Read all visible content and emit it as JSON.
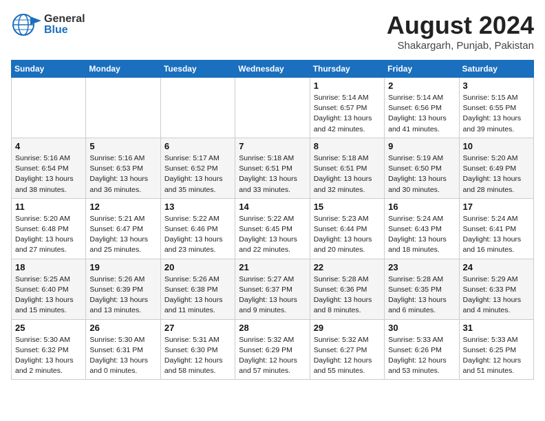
{
  "header": {
    "logo_general": "General",
    "logo_blue": "Blue",
    "month": "August 2024",
    "location": "Shakargarh, Punjab, Pakistan"
  },
  "days_of_week": [
    "Sunday",
    "Monday",
    "Tuesday",
    "Wednesday",
    "Thursday",
    "Friday",
    "Saturday"
  ],
  "weeks": [
    [
      {
        "num": "",
        "info": ""
      },
      {
        "num": "",
        "info": ""
      },
      {
        "num": "",
        "info": ""
      },
      {
        "num": "",
        "info": ""
      },
      {
        "num": "1",
        "info": "Sunrise: 5:14 AM\nSunset: 6:57 PM\nDaylight: 13 hours\nand 42 minutes."
      },
      {
        "num": "2",
        "info": "Sunrise: 5:14 AM\nSunset: 6:56 PM\nDaylight: 13 hours\nand 41 minutes."
      },
      {
        "num": "3",
        "info": "Sunrise: 5:15 AM\nSunset: 6:55 PM\nDaylight: 13 hours\nand 39 minutes."
      }
    ],
    [
      {
        "num": "4",
        "info": "Sunrise: 5:16 AM\nSunset: 6:54 PM\nDaylight: 13 hours\nand 38 minutes."
      },
      {
        "num": "5",
        "info": "Sunrise: 5:16 AM\nSunset: 6:53 PM\nDaylight: 13 hours\nand 36 minutes."
      },
      {
        "num": "6",
        "info": "Sunrise: 5:17 AM\nSunset: 6:52 PM\nDaylight: 13 hours\nand 35 minutes."
      },
      {
        "num": "7",
        "info": "Sunrise: 5:18 AM\nSunset: 6:51 PM\nDaylight: 13 hours\nand 33 minutes."
      },
      {
        "num": "8",
        "info": "Sunrise: 5:18 AM\nSunset: 6:51 PM\nDaylight: 13 hours\nand 32 minutes."
      },
      {
        "num": "9",
        "info": "Sunrise: 5:19 AM\nSunset: 6:50 PM\nDaylight: 13 hours\nand 30 minutes."
      },
      {
        "num": "10",
        "info": "Sunrise: 5:20 AM\nSunset: 6:49 PM\nDaylight: 13 hours\nand 28 minutes."
      }
    ],
    [
      {
        "num": "11",
        "info": "Sunrise: 5:20 AM\nSunset: 6:48 PM\nDaylight: 13 hours\nand 27 minutes."
      },
      {
        "num": "12",
        "info": "Sunrise: 5:21 AM\nSunset: 6:47 PM\nDaylight: 13 hours\nand 25 minutes."
      },
      {
        "num": "13",
        "info": "Sunrise: 5:22 AM\nSunset: 6:46 PM\nDaylight: 13 hours\nand 23 minutes."
      },
      {
        "num": "14",
        "info": "Sunrise: 5:22 AM\nSunset: 6:45 PM\nDaylight: 13 hours\nand 22 minutes."
      },
      {
        "num": "15",
        "info": "Sunrise: 5:23 AM\nSunset: 6:44 PM\nDaylight: 13 hours\nand 20 minutes."
      },
      {
        "num": "16",
        "info": "Sunrise: 5:24 AM\nSunset: 6:43 PM\nDaylight: 13 hours\nand 18 minutes."
      },
      {
        "num": "17",
        "info": "Sunrise: 5:24 AM\nSunset: 6:41 PM\nDaylight: 13 hours\nand 16 minutes."
      }
    ],
    [
      {
        "num": "18",
        "info": "Sunrise: 5:25 AM\nSunset: 6:40 PM\nDaylight: 13 hours\nand 15 minutes."
      },
      {
        "num": "19",
        "info": "Sunrise: 5:26 AM\nSunset: 6:39 PM\nDaylight: 13 hours\nand 13 minutes."
      },
      {
        "num": "20",
        "info": "Sunrise: 5:26 AM\nSunset: 6:38 PM\nDaylight: 13 hours\nand 11 minutes."
      },
      {
        "num": "21",
        "info": "Sunrise: 5:27 AM\nSunset: 6:37 PM\nDaylight: 13 hours\nand 9 minutes."
      },
      {
        "num": "22",
        "info": "Sunrise: 5:28 AM\nSunset: 6:36 PM\nDaylight: 13 hours\nand 8 minutes."
      },
      {
        "num": "23",
        "info": "Sunrise: 5:28 AM\nSunset: 6:35 PM\nDaylight: 13 hours\nand 6 minutes."
      },
      {
        "num": "24",
        "info": "Sunrise: 5:29 AM\nSunset: 6:33 PM\nDaylight: 13 hours\nand 4 minutes."
      }
    ],
    [
      {
        "num": "25",
        "info": "Sunrise: 5:30 AM\nSunset: 6:32 PM\nDaylight: 13 hours\nand 2 minutes."
      },
      {
        "num": "26",
        "info": "Sunrise: 5:30 AM\nSunset: 6:31 PM\nDaylight: 13 hours\nand 0 minutes."
      },
      {
        "num": "27",
        "info": "Sunrise: 5:31 AM\nSunset: 6:30 PM\nDaylight: 12 hours\nand 58 minutes."
      },
      {
        "num": "28",
        "info": "Sunrise: 5:32 AM\nSunset: 6:29 PM\nDaylight: 12 hours\nand 57 minutes."
      },
      {
        "num": "29",
        "info": "Sunrise: 5:32 AM\nSunset: 6:27 PM\nDaylight: 12 hours\nand 55 minutes."
      },
      {
        "num": "30",
        "info": "Sunrise: 5:33 AM\nSunset: 6:26 PM\nDaylight: 12 hours\nand 53 minutes."
      },
      {
        "num": "31",
        "info": "Sunrise: 5:33 AM\nSunset: 6:25 PM\nDaylight: 12 hours\nand 51 minutes."
      }
    ]
  ]
}
